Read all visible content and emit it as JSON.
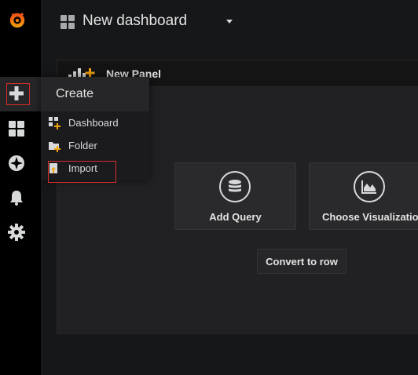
{
  "topbar": {
    "dashboard_title": "New dashboard"
  },
  "panel": {
    "title": "New Panel",
    "actions": {
      "add_query": "Add Query",
      "choose_visualization": "Choose Visualization",
      "convert_to_row": "Convert to row"
    }
  },
  "create_menu": {
    "title": "Create",
    "items": [
      {
        "label": "Dashboard",
        "icon": "dashboard-plus-icon"
      },
      {
        "label": "Folder",
        "icon": "folder-plus-icon"
      },
      {
        "label": "Import",
        "icon": "import-icon"
      }
    ]
  },
  "sidebar": {
    "items": [
      {
        "icon": "grafana-logo"
      },
      {
        "icon": "plus-icon"
      },
      {
        "icon": "dashboards-grid-icon"
      },
      {
        "icon": "explore-compass-icon"
      },
      {
        "icon": "bell-alert-icon"
      },
      {
        "icon": "gear-icon"
      }
    ]
  },
  "colors": {
    "background": "#161719",
    "sidebar": "#000000",
    "panel": "#212124",
    "accent_orange": "#f0a30a",
    "highlight_red": "#d62c2c"
  }
}
